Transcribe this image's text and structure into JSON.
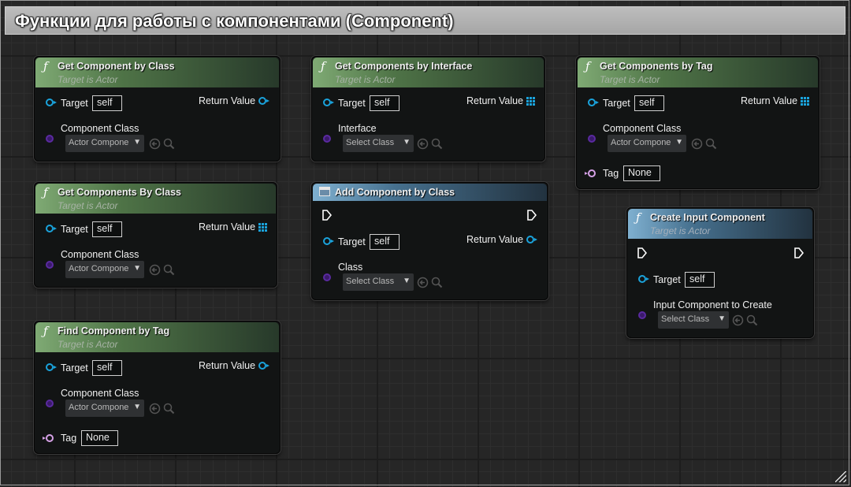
{
  "comment": {
    "title": "Функции для работы с компонентами (Component)"
  },
  "common": {
    "target_label": "Target",
    "target_value": "self",
    "subtitle": "Target is Actor",
    "return_label": "Return Value",
    "component_class_label": "Component Class",
    "actor_component_value": "Actor Compone",
    "select_class_value": "Select Class",
    "tag_label": "Tag",
    "tag_value": "None",
    "icons": {
      "function": "function-icon",
      "event": "component-node-icon",
      "use": "use-asset-icon",
      "browse": "browse-icon",
      "exec": "exec-pin-icon"
    }
  },
  "nodes": {
    "get_component_by_class": {
      "title": "Get Component by Class"
    },
    "get_components_by_class": {
      "title": "Get Components By Class"
    },
    "find_component_by_tag": {
      "title": "Find Component by Tag"
    },
    "get_components_by_interface": {
      "title": "Get Components by Interface",
      "interface_label": "Interface"
    },
    "add_component_by_class": {
      "title": "Add Component by Class",
      "class_label": "Class"
    },
    "get_components_by_tag": {
      "title": "Get Components by Tag"
    },
    "create_input_component": {
      "title": "Create Input Component",
      "input_label": "Input Component to Create"
    }
  },
  "colors": {
    "function_header": "#5a8a4f",
    "component_header": "#46708e",
    "object_pin": "#1aa3dc",
    "class_pin": "#5a2aa0",
    "name_pin": "#d7a2e8"
  }
}
